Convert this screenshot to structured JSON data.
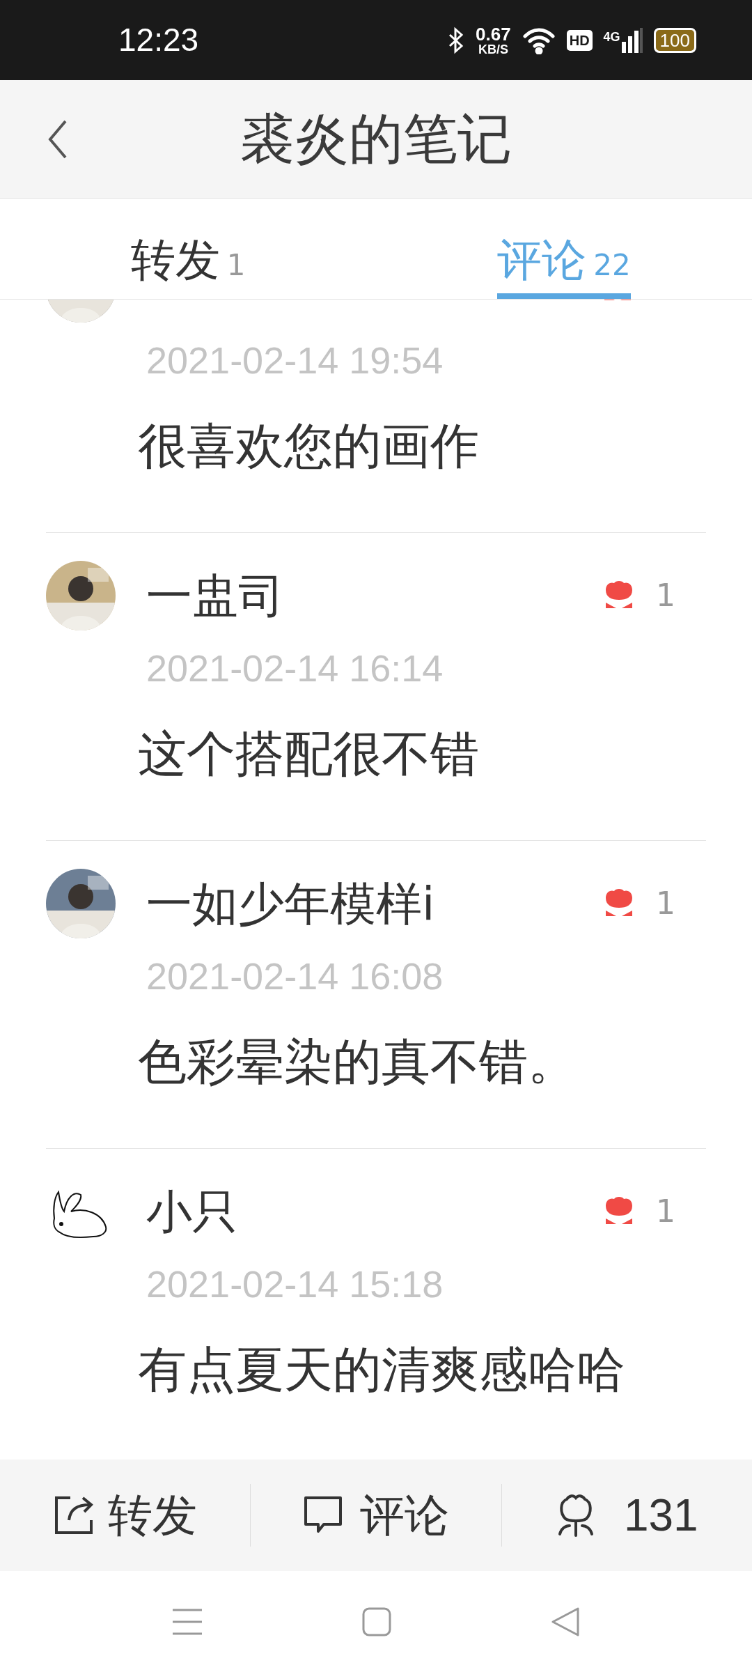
{
  "status_bar": {
    "time": "12:23",
    "speed_value": "0.67",
    "speed_unit": "KB/S",
    "hd": "HD",
    "network": "4G",
    "battery": "100"
  },
  "header": {
    "title": "裘炎的笔记"
  },
  "tabs": [
    {
      "label": "转发",
      "count": "1",
      "selected": false
    },
    {
      "label": "评论",
      "count": "22",
      "selected": true
    }
  ],
  "comments": [
    {
      "time": "2021-02-14 19:54",
      "text": "很喜欢您的画作"
    },
    {
      "name": "一盅司",
      "likes": "1",
      "time": "2021-02-14 16:14",
      "text": "这个搭配很不错"
    },
    {
      "name": "一如少年模样i",
      "likes": "1",
      "time": "2021-02-14 16:08",
      "text": "色彩晕染的真不错。"
    },
    {
      "avatar": {
        "kind": "sketch"
      },
      "name": "小只",
      "likes": "1",
      "time": "2021-02-14 15:18",
      "text": "有点夏天的清爽感哈哈"
    }
  ],
  "bottom_bar": {
    "repost": "转发",
    "comment": "评论",
    "likes": "131"
  }
}
